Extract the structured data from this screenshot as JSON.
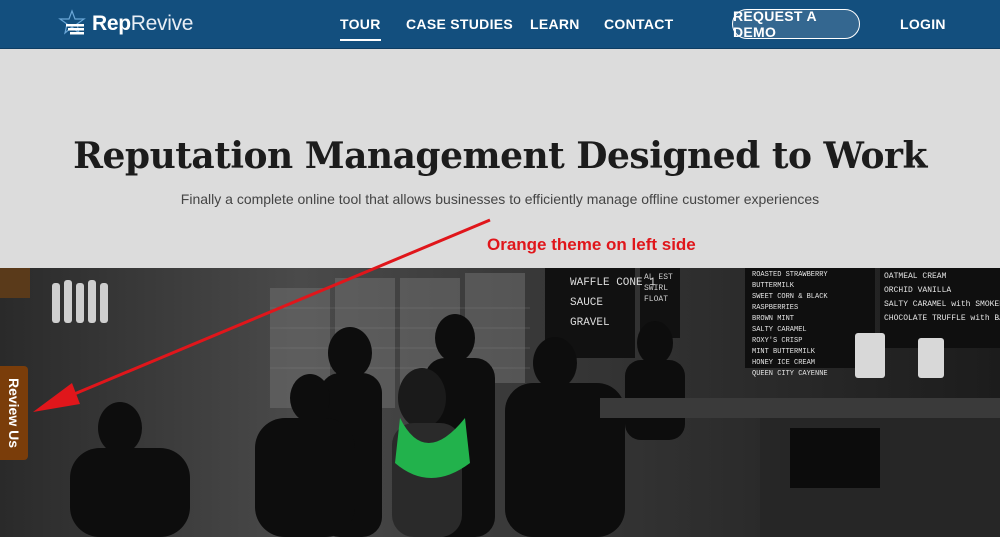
{
  "nav": {
    "logo_bold": "Rep",
    "logo_light": "Revive",
    "links": [
      {
        "label": "TOUR",
        "active": true
      },
      {
        "label": "CASE STUDIES",
        "active": false
      },
      {
        "label": "LEARN",
        "active": false
      },
      {
        "label": "CONTACT",
        "active": false
      }
    ],
    "demo_label": "REQUEST A DEMO",
    "login_label": "LOGIN",
    "bar_color": "#134f7e"
  },
  "hero": {
    "title": "Reputation Management Designed to Work",
    "subtitle": "Finally a complete online tool that allows businesses to efficiently manage offline customer experiences"
  },
  "annotation": {
    "text": "Orange theme on left side",
    "color": "#e0161b"
  },
  "review_tab": {
    "label": "Review Us",
    "color": "#7a3d0a"
  },
  "menu_board": {
    "left_items": [
      "WAFFLE CONE 1",
      "SAUCE",
      "GRAVEL"
    ],
    "left_prices": [
      "AL EST",
      "SWIRL",
      "FLOAT"
    ],
    "center_items": [
      "ROASTED STRAWBERRY BUTTERMILK",
      "SWEET CORN & BLACK RASPBERRIES",
      "BROWN MINT",
      "SALTY CARAMEL",
      "ROXY'S CRISP",
      "MINT BUTTERMILK",
      "HONEY ICE CREAM",
      "QUEEN CITY CAYENNE"
    ],
    "right_items": [
      "OATMEAL CREAM",
      "ORCHID VANILLA",
      "SALTY CARAMEL with SMOKED ALMONDS",
      "CHOCOLATE TRUFFLE with BACKYARD"
    ]
  }
}
